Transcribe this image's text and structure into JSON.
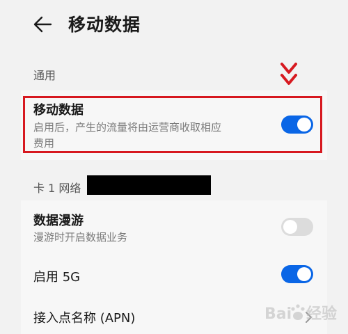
{
  "header": {
    "title": "移动数据"
  },
  "general": {
    "section_label": "通用",
    "mobile_data": {
      "title": "移动数据",
      "subtitle_line1": "启用后，产生的流量将由运营商收取相应",
      "subtitle_line2": "费用",
      "enabled": true
    }
  },
  "card1": {
    "label": "卡 1 网络",
    "roaming": {
      "title": "数据漫游",
      "subtitle": "漫游时开启数据业务",
      "enabled": false
    },
    "enable_5g": {
      "title": "启用 5G",
      "enabled": true
    },
    "apn": {
      "title": "接入点名称 (APN)"
    }
  },
  "colors": {
    "accent": "#0a66e6",
    "highlight": "#d71920",
    "toggle_off": "#dcdcdc"
  },
  "icons": {
    "back": "back-arrow-icon",
    "arrow_down": "double-chevron-down-icon",
    "chevron": "chevron-right-icon"
  },
  "watermark": {
    "text": "Bai 经验"
  }
}
